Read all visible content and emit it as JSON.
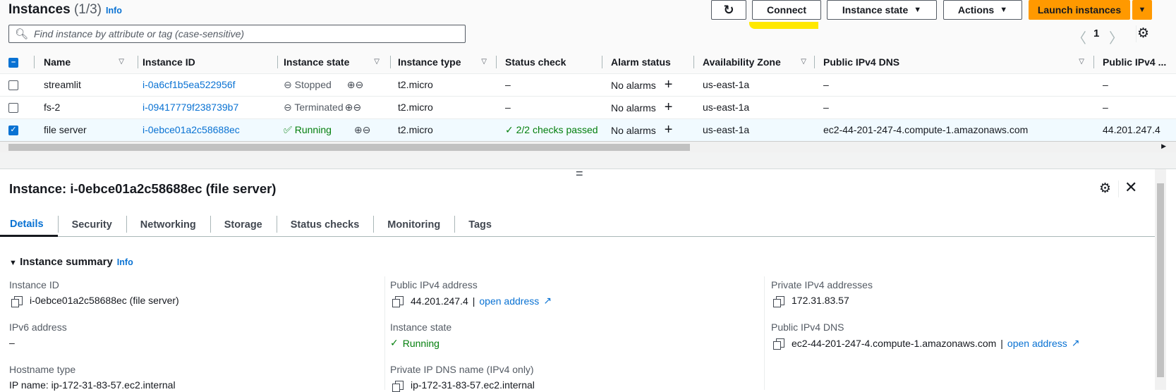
{
  "header": {
    "title": "Instances",
    "count": "(1/3)",
    "info": "Info"
  },
  "toolbar": {
    "refresh_icon": "refresh-icon",
    "connect": "Connect",
    "instance_state": "Instance state",
    "actions": "Actions",
    "launch": "Launch instances"
  },
  "search": {
    "placeholder": "Find instance by attribute or tag (case-sensitive)"
  },
  "pagination": {
    "page": "1"
  },
  "table": {
    "columns": [
      "Name",
      "Instance ID",
      "Instance state",
      "Instance type",
      "Status check",
      "Alarm status",
      "Availability Zone",
      "Public IPv4 DNS",
      "Public IPv4 ..."
    ],
    "rows": [
      {
        "selected": false,
        "name": "streamlit",
        "id": "i-0a6cf1b5ea522956f",
        "state": "Stopped",
        "type": "t2.micro",
        "status": "–",
        "alarm": "No alarms",
        "az": "us-east-1a",
        "dns": "–",
        "ipv4": "–"
      },
      {
        "selected": false,
        "name": "fs-2",
        "id": "i-09417779f238739b7",
        "state": "Terminated",
        "type": "t2.micro",
        "status": "–",
        "alarm": "No alarms",
        "az": "us-east-1a",
        "dns": "–",
        "ipv4": "–"
      },
      {
        "selected": true,
        "name": "file server",
        "id": "i-0ebce01a2c58688ec",
        "state": "Running",
        "type": "t2.micro",
        "status": "2/2 checks passed",
        "alarm": "No alarms",
        "az": "us-east-1a",
        "dns": "ec2-44-201-247-4.compute-1.amazonaws.com",
        "ipv4": "44.201.247.4"
      }
    ]
  },
  "details": {
    "title": "Instance: i-0ebce01a2c58688ec (file server)",
    "tabs": [
      "Details",
      "Security",
      "Networking",
      "Storage",
      "Status checks",
      "Monitoring",
      "Tags"
    ],
    "section": "Instance summary",
    "section_info": "Info",
    "fields": {
      "instance_id_label": "Instance ID",
      "instance_id": "i-0ebce01a2c58688ec (file server)",
      "ipv6_label": "IPv6 address",
      "ipv6": "–",
      "hostname_label": "Hostname type",
      "hostname": "IP name: ip-172-31-83-57.ec2.internal",
      "public_ip_label": "Public IPv4 address",
      "public_ip": "44.201.247.4",
      "open_address": "open address",
      "state_label": "Instance state",
      "state": "Running",
      "private_dns_label": "Private IP DNS name (IPv4 only)",
      "private_dns": "ip-172-31-83-57.ec2.internal",
      "private_ip_label": "Private IPv4 addresses",
      "private_ip": "172.31.83.57",
      "public_dns_label": "Public IPv4 DNS",
      "public_dns": "ec2-44-201-247-4.compute-1.amazonaws.com"
    }
  },
  "colors": {
    "accent": "#0972d3",
    "launch": "#ff9900",
    "running": "#037f0c",
    "highlight": "#ffe800"
  }
}
